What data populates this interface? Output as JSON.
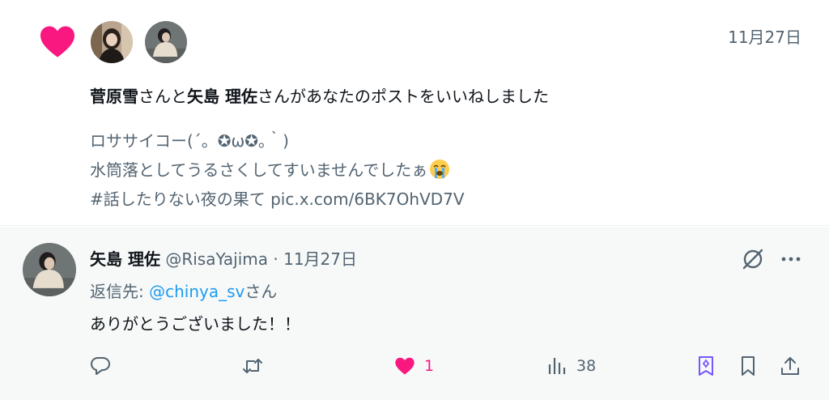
{
  "notification": {
    "date": "11月27日",
    "liker1": "菅原雪",
    "text_and": "さんと",
    "liker2": "矢島 理佐",
    "text_rest": "さんがあなたのポストをいいねしました",
    "post_line1": "ロササイコー(´。✪ω✪｡｀)",
    "post_line2": "水筒落としてうるさくしてすいませんでしたぁ",
    "post_line3": "#話したりない夜の果て pic.x.com/6BK7OhVD7V",
    "icons": {
      "like": "heart-icon",
      "emoji": "loudly-crying-face-emoji"
    }
  },
  "reply": {
    "author_name": "矢島 理佐",
    "handle": "@RisaYajima",
    "separator": "·",
    "date": "11月27日",
    "reply_to_label": "返信先: ",
    "reply_to_user": "@chinya_sv",
    "reply_to_suffix": "さん",
    "text": "ありがとうございました！！",
    "actions": {
      "reply_count": "",
      "retweet_count": "",
      "like_count": "1",
      "views_count": "38"
    }
  },
  "colors": {
    "like_pink": "#f91880",
    "mention_blue": "#1d9bf0",
    "grok_purple": "#7856ff",
    "muted_gray": "#536471",
    "reply_bg": "#f7f9f9"
  }
}
